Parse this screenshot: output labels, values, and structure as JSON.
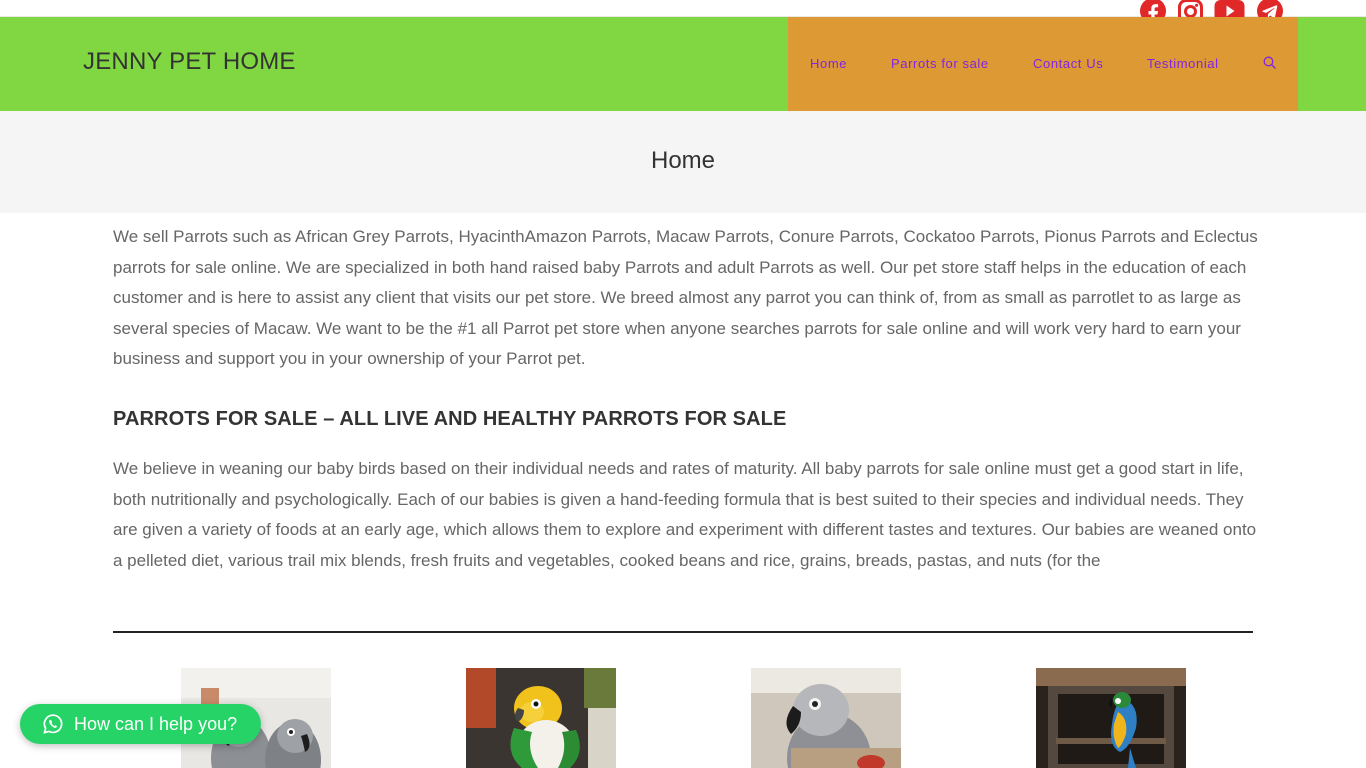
{
  "social": {
    "items": [
      {
        "name": "facebook-icon",
        "color": "#e12828"
      },
      {
        "name": "instagram-icon",
        "color": "#e12828"
      },
      {
        "name": "youtube-icon",
        "color": "#e12828"
      },
      {
        "name": "telegram-icon",
        "color": "#e12828"
      }
    ]
  },
  "header": {
    "site_title": "JENNY PET HOME",
    "nav": [
      {
        "label": "Home"
      },
      {
        "label": "Parrots for sale"
      },
      {
        "label": "Contact Us"
      },
      {
        "label": "Testimonial"
      }
    ],
    "search_icon": "search-icon"
  },
  "page": {
    "title": "Home"
  },
  "content": {
    "intro": "We sell Parrots such as African Grey Parrots, HyacinthAmazon Parrots, Macaw Parrots, Conure Parrots, Cockatoo Parrots, Pionus Parrots and Eclectus parrots for sale online. We are specialized in both hand raised baby Parrots and adult Parrots as well. Our pet store staff helps in the education of each customer and is here to assist any client that visits our pet store. We breed almost any parrot you can think of, from as small as parrotlet to as large as several species of Macaw. We want to be the #1 all Parrot pet store when anyone searches parrots for sale online and will work very hard to earn your business and support you in your ownership of your Parrot pet.",
    "heading": "PARROTS FOR SALE – ALL LIVE AND HEALTHY PARROTS FOR SALE",
    "body": "We believe in weaning our baby birds based on their individual needs and rates of maturity. All baby parrots for sale online must get a good start in life, both nutritionally and psychologically. Each of our babies is given a hand-feeding formula that is best suited to their species and individual needs. They are given a variety of foods at an early age, which allows them to explore and experiment with different tastes and textures. Our babies are weaned onto a pelleted diet, various trail mix blends, fresh fruits and vegetables, cooked beans and rice, grains, breads, pastas, and nuts (for the"
  },
  "products": [
    {
      "image": "african-grey-pair-photo"
    },
    {
      "image": "caique-parrot-photo"
    },
    {
      "image": "african-grey-photo"
    },
    {
      "image": "blue-gold-macaw-photo"
    }
  ],
  "whatsapp": {
    "label": "How can I help you?",
    "color": "#25d366",
    "icon": "whatsapp-icon"
  },
  "colors": {
    "header_bg": "#81d742",
    "nav_bg": "#dd9933",
    "nav_link": "#8224e3",
    "social": "#e12828",
    "title_band": "#f5f5f5"
  }
}
